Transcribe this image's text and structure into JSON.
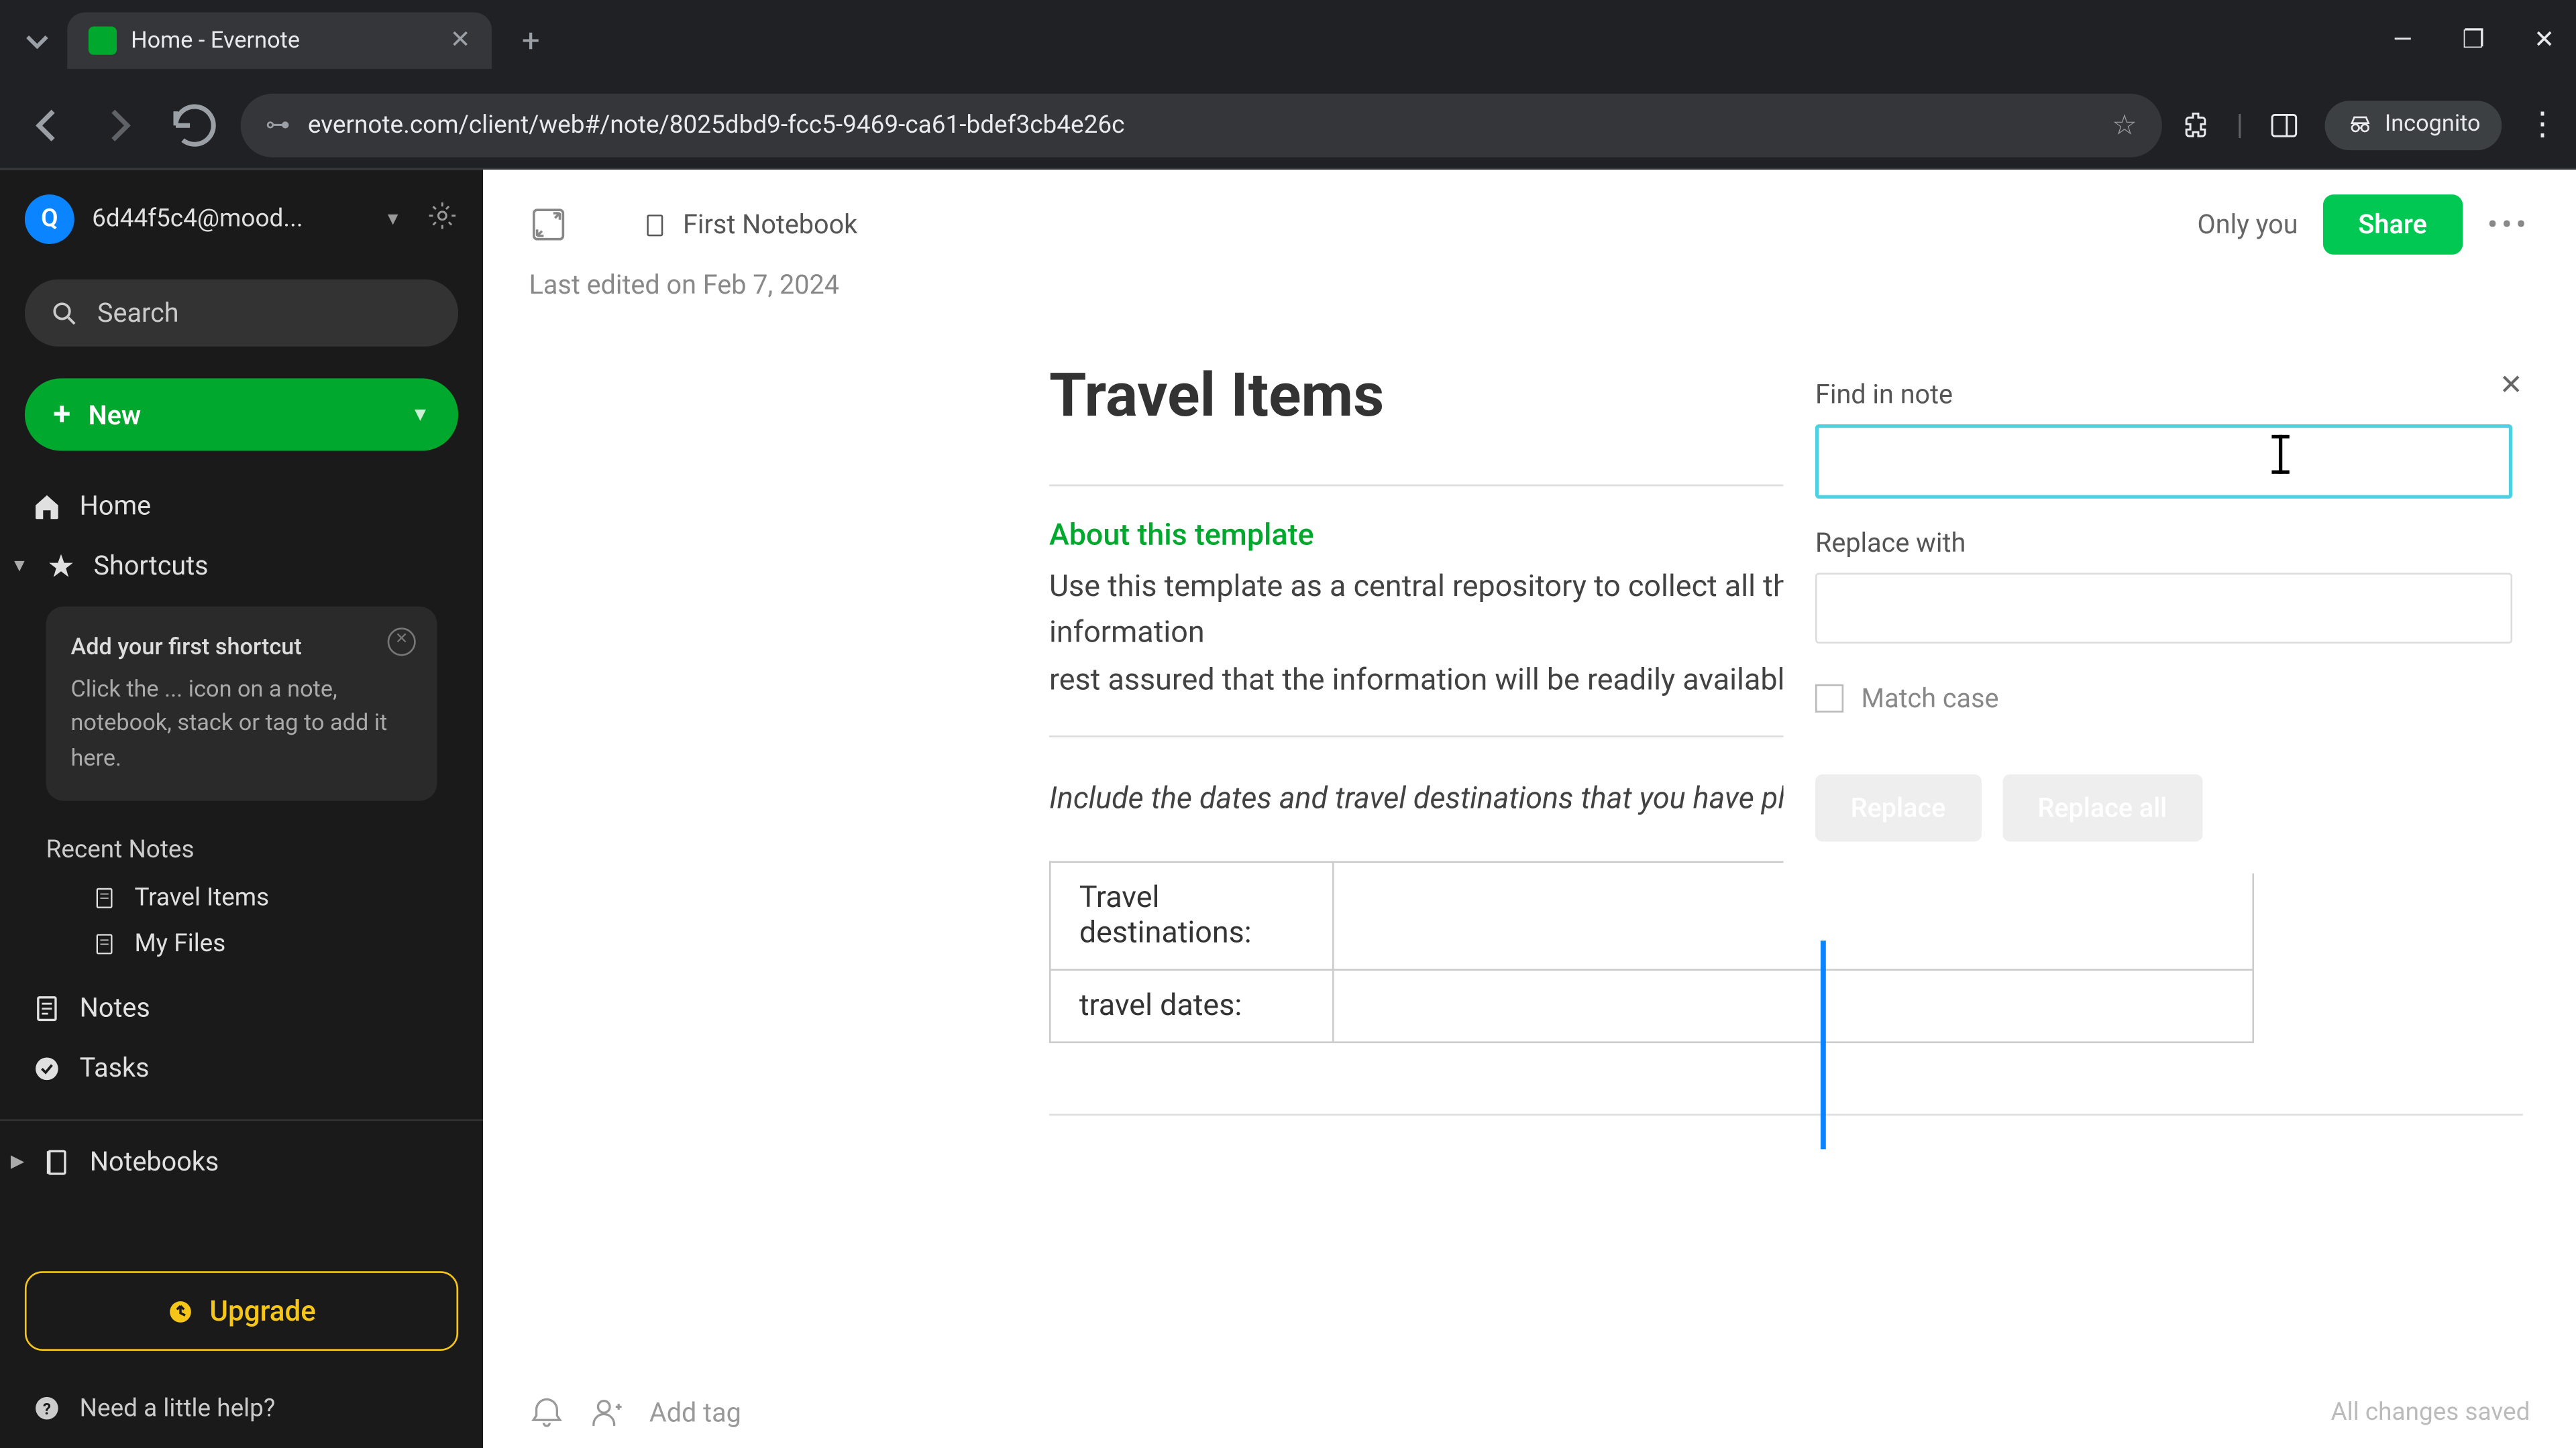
{
  "browser": {
    "tab_title": "Home - Evernote",
    "url": "evernote.com/client/web#/note/8025dbd9-fcc5-9469-ca61-bdef3cb4e26c",
    "incognito_label": "Incognito"
  },
  "sidebar": {
    "avatar_letter": "Q",
    "user_email": "6d44f5c4@mood...",
    "search_label": "Search",
    "new_label": "New",
    "nav": {
      "home": "Home",
      "shortcuts": "Shortcuts",
      "notes": "Notes",
      "tasks": "Tasks",
      "notebooks": "Notebooks"
    },
    "hint_title": "Add your first shortcut",
    "hint_body": "Click the ... icon on a note, notebook, stack or tag to add it here.",
    "recent_label": "Recent Notes",
    "recent": [
      "Travel Items",
      "My Files"
    ],
    "upgrade": "Upgrade",
    "need_help": "Need a little help?"
  },
  "topbar": {
    "notebook": "First Notebook",
    "only_you": "Only you",
    "share": "Share",
    "last_edited": "Last edited on Feb 7, 2024"
  },
  "note": {
    "title": "Travel Items",
    "about_heading": "About this template",
    "about_p1": "Use this template as a central repository to collect all the most important information",
    "about_p2": "rest assured that the information will be readily available at a moment's notice.",
    "include_line": "Include the dates and travel destinations that you have planned for your trip in this se",
    "row1": "Travel destinations:",
    "row2": "travel dates:"
  },
  "find": {
    "find_label": "Find in note",
    "replace_label": "Replace with",
    "match_case": "Match case",
    "replace_btn": "Replace",
    "replace_all": "Replace all"
  },
  "footer": {
    "add_tag": "Add tag",
    "saved": "All changes saved"
  }
}
